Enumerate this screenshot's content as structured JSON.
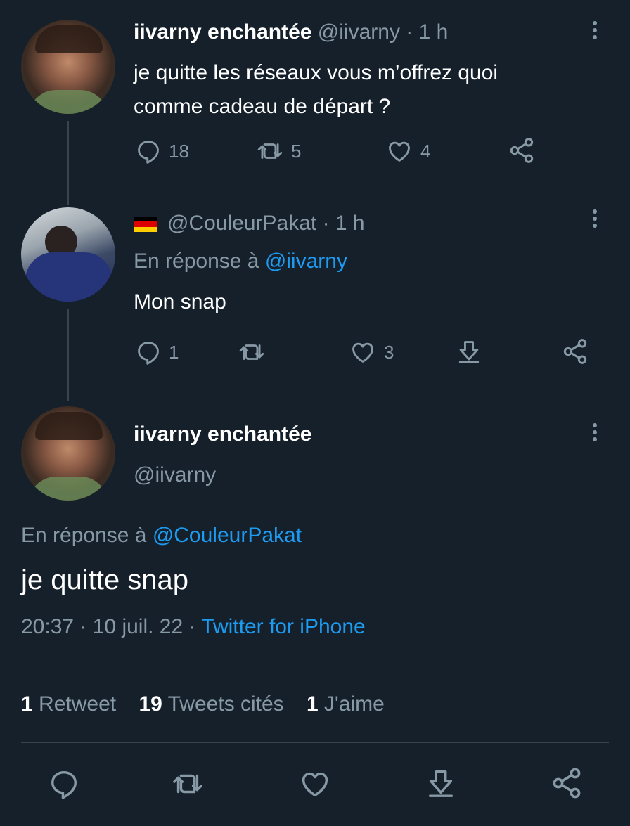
{
  "tweets": [
    {
      "display_name": "iivarny enchantée",
      "handle": "@iivarny",
      "time": "· 1 h",
      "text_line1": "je quitte les réseaux vous m’offrez quoi",
      "text_line2": "comme cadeau de départ ?",
      "reply_count": "18",
      "retweet_count": "5",
      "like_count": "4"
    },
    {
      "handle": "@CouleurPakat",
      "time": "· 1 h",
      "reply_prefix": "En réponse à",
      "reply_to": "@iivarny",
      "text": "Mon snap",
      "reply_count": "1",
      "like_count": "3"
    }
  ],
  "focused": {
    "display_name": "iivarny enchantée",
    "handle": "@iivarny",
    "reply_prefix": "En réponse à",
    "reply_to": "@CouleurPakat",
    "text": "je quitte snap",
    "timestamp": "20:37 · 10 juil. 22 ·",
    "source": "Twitter for iPhone",
    "stats": {
      "retweets_num": "1",
      "retweets_label": "Retweet",
      "quotes_num": "19",
      "quotes_label": "Tweets cités",
      "likes_num": "1",
      "likes_label": "J'aime"
    }
  },
  "colors": {
    "background": "#15202b",
    "muted": "#8899a6",
    "link": "#1d9bf0",
    "divider": "#38444d"
  },
  "icons": [
    "reply-icon",
    "retweet-icon",
    "like-icon",
    "download-icon",
    "share-icon",
    "more-icon",
    "germany-flag-icon"
  ]
}
